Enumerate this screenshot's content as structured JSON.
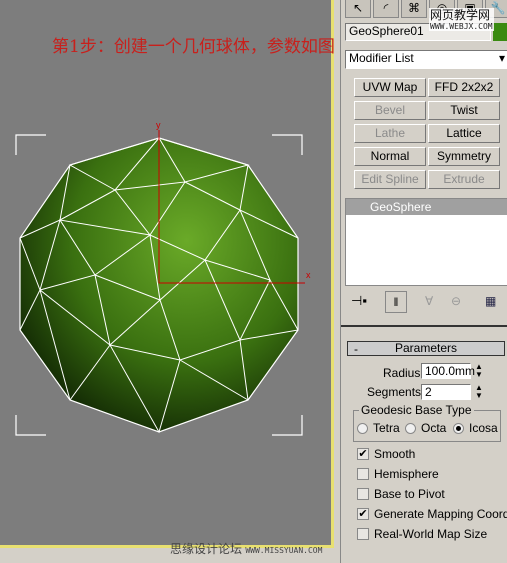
{
  "caption": "第1步：创建一个几何球体，参数如图",
  "watermark_top": {
    "title": "网页教学网",
    "url": "WWW.WEBJX.COM"
  },
  "watermark_bottom": {
    "title": "思缘设计论坛",
    "url": "WWW.MISSYUAN.COM"
  },
  "viewport": {
    "axis_x": "x",
    "axis_y": "y",
    "object_color": "#5a9a20"
  },
  "panel": {
    "tabs": [
      "create-icon",
      "modify-icon",
      "hierarchy-icon",
      "motion-icon",
      "display-icon",
      "utilities-icon"
    ],
    "object_name": "GeoSphere01",
    "object_color": "#3a8a10",
    "modifier_list": "Modifier List",
    "modifier_buttons": [
      {
        "label": "UVW Map",
        "enabled": true
      },
      {
        "label": "FFD 2x2x2",
        "enabled": true
      },
      {
        "label": "Bevel",
        "enabled": false
      },
      {
        "label": "Twist",
        "enabled": true
      },
      {
        "label": "Lathe",
        "enabled": false
      },
      {
        "label": "Lattice",
        "enabled": true
      },
      {
        "label": "Normal",
        "enabled": true
      },
      {
        "label": "Symmetry",
        "enabled": true
      },
      {
        "label": "Edit Spline",
        "enabled": false
      },
      {
        "label": "Extrude",
        "enabled": false
      }
    ],
    "stack_item": "GeoSphere",
    "rollout_minus": "-",
    "rollout_title": "Parameters",
    "radius_label": "Radius:",
    "radius": "100.0mm",
    "segments_label": "Segments:",
    "segments": "2",
    "base_type_label": "Geodesic Base Type",
    "base_types": [
      {
        "label": "Tetra",
        "selected": false
      },
      {
        "label": "Octa",
        "selected": false
      },
      {
        "label": "Icosa",
        "selected": true
      }
    ],
    "options": [
      {
        "label": "Smooth",
        "checked": true
      },
      {
        "label": "Hemisphere",
        "checked": false
      },
      {
        "label": "Base to Pivot",
        "checked": false
      },
      {
        "label": "Generate Mapping Coords.",
        "checked": true
      },
      {
        "label": "Real-World Map Size",
        "checked": false
      }
    ]
  }
}
